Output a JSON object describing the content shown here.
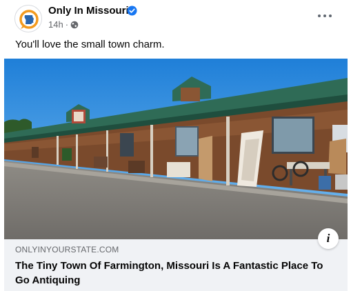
{
  "post": {
    "page_name": "Only In Missouri",
    "verified": true,
    "timestamp": "14h",
    "audience_icon": "globe-icon",
    "more_icon": "more-options-icon",
    "text": "You'll love the small town charm."
  },
  "link_preview": {
    "image_alt": "Row of antique shops with green roofs on a small town street",
    "domain": "ONLYINYOURSTATE.COM",
    "headline": "The Tiny Town Of Farmington, Missouri Is A Fantastic Place To Go Antiquing",
    "info_icon": "info-icon"
  },
  "colors": {
    "verified_blue": "#1877f2",
    "secondary_text": "#65676b",
    "card_background": "#f0f2f5",
    "avatar_orange": "#f39a1f",
    "avatar_blue": "#2a65ad"
  }
}
